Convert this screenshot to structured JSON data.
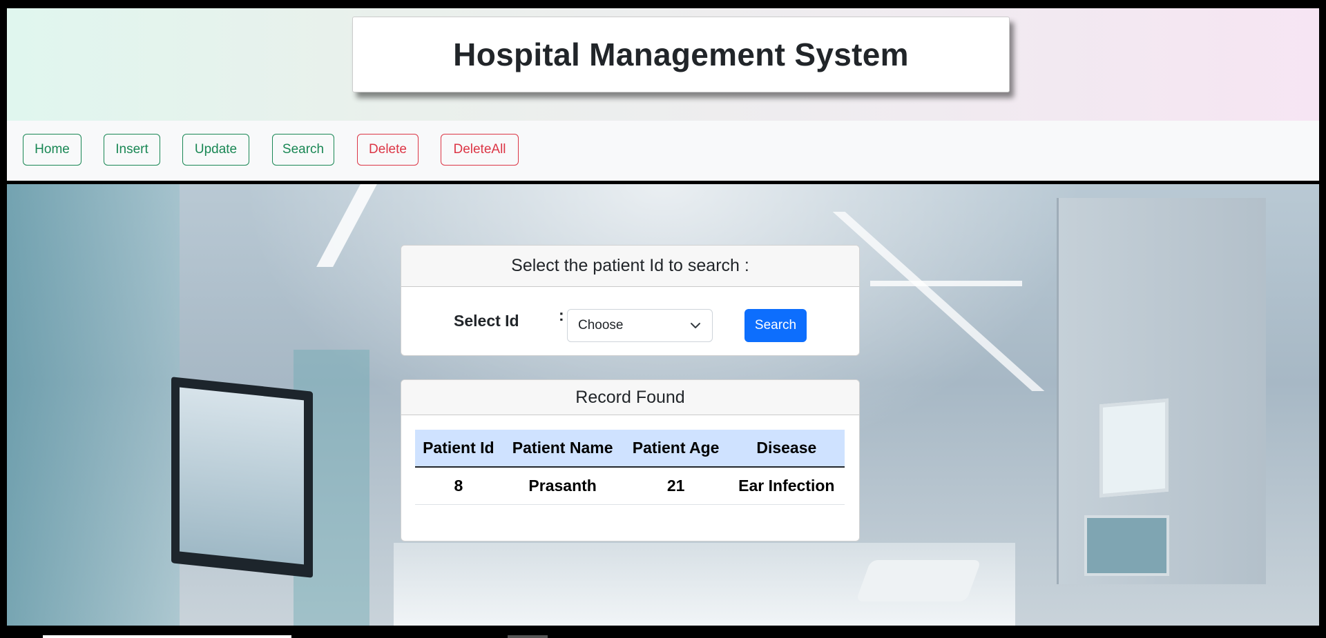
{
  "header": {
    "title": "Hospital Management System"
  },
  "nav": {
    "items": [
      {
        "label": "Home"
      },
      {
        "label": "Insert"
      },
      {
        "label": "Update"
      },
      {
        "label": "Search"
      },
      {
        "label": "Delete"
      },
      {
        "label": "DeleteAll"
      }
    ]
  },
  "search_form": {
    "heading": "Select the patient Id to search :",
    "label": "Select Id",
    "colon": ":",
    "select_value": "Choose",
    "button_label": "Search"
  },
  "results": {
    "heading": "Record Found",
    "columns": [
      "Patient Id",
      "Patient Name",
      "Patient Age",
      "Disease"
    ],
    "rows": [
      [
        "8",
        "Prasanth",
        "21",
        "Ear Infection"
      ]
    ]
  },
  "colors": {
    "success": "#198754",
    "danger": "#dc3545",
    "primary": "#0d6efd",
    "table_header": "#cfe2ff"
  },
  "icons": {
    "select_caret": "chevron-down-icon"
  }
}
